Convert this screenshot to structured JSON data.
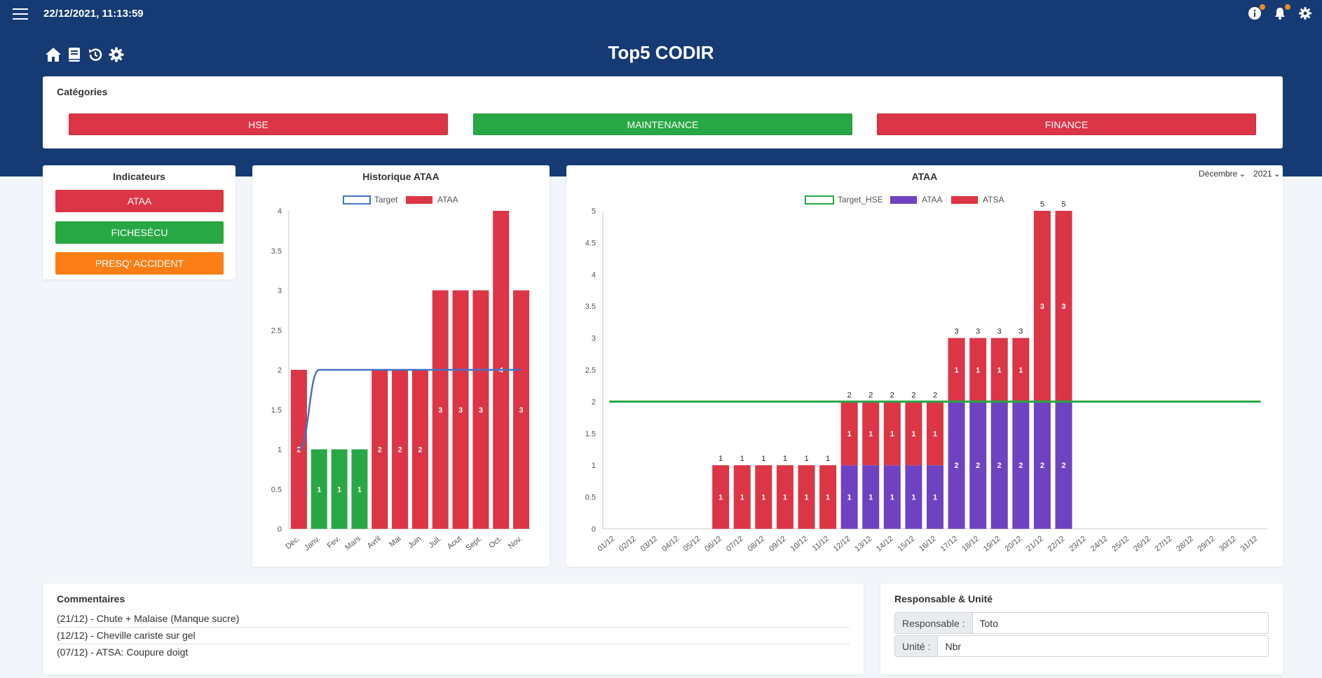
{
  "header": {
    "datetime": "22/12/2021, 11:13:59",
    "title": "Top5 CODIR"
  },
  "categories": {
    "label": "Catégories",
    "items": [
      {
        "label": "HSE",
        "color": "#dc3545"
      },
      {
        "label": "MAINTENANCE",
        "color": "#28a745"
      },
      {
        "label": "FINANCE",
        "color": "#dc3545"
      }
    ]
  },
  "indicators": {
    "title": "Indicateurs",
    "items": [
      {
        "label": "ATAA",
        "color": "#dc3545"
      },
      {
        "label": "FICHESÉCU",
        "color": "#28a745"
      },
      {
        "label": "PRESQ' ACCIDENT",
        "color": "#fd7e14"
      }
    ]
  },
  "selectors": {
    "month": "Décembre",
    "year": "2021"
  },
  "comments": {
    "title": "Commentaires",
    "items": [
      "(21/12) - Chute + Malaise (Manque sucre)",
      "(12/12) - Cheville cariste sur gel",
      "(07/12) - ATSA: Coupure doigt"
    ]
  },
  "responsable": {
    "title": "Responsable & Unité",
    "responsable_label": "Responsable :",
    "responsable_value": "Toto",
    "unite_label": "Unité :",
    "unite_value": "Nbr"
  },
  "chart_data": [
    {
      "type": "bar",
      "title": "Historique ATAA",
      "categories": [
        "Déc.",
        "Janv.",
        "Fev.",
        "Mars",
        "Avril",
        "Mai",
        "Juin",
        "Juil.",
        "Aout",
        "Sept.",
        "Oct.",
        "Nov."
      ],
      "series": [
        {
          "name": "ATAA",
          "type": "bar",
          "values": [
            2,
            1,
            1,
            1,
            2,
            2,
            2,
            3,
            3,
            3,
            4,
            3
          ],
          "colors": [
            "#dc3545",
            "#28a745",
            "#28a745",
            "#28a745",
            "#dc3545",
            "#dc3545",
            "#dc3545",
            "#dc3545",
            "#dc3545",
            "#dc3545",
            "#dc3545",
            "#dc3545"
          ]
        },
        {
          "name": "Target",
          "type": "line",
          "values": [
            1,
            2,
            2,
            2,
            2,
            2,
            2,
            2,
            2,
            2,
            2,
            2
          ],
          "color": "#4472c4"
        }
      ],
      "ylim": [
        0,
        4
      ],
      "yticks": [
        0,
        0.5,
        1,
        1.5,
        2,
        2.5,
        3,
        3.5,
        4
      ],
      "legend": "top",
      "grid": false
    },
    {
      "type": "bar",
      "stacked": true,
      "title": "ATAA",
      "categories": [
        "01/12",
        "02/12",
        "03/12",
        "04/12",
        "05/12",
        "06/12",
        "07/12",
        "08/12",
        "09/12",
        "10/12",
        "11/12",
        "12/12",
        "13/12",
        "14/12",
        "15/12",
        "16/12",
        "17/12",
        "18/12",
        "19/12",
        "20/12",
        "21/12",
        "22/12",
        "23/12",
        "24/12",
        "25/12",
        "26/12",
        "27/12",
        "28/12",
        "29/12",
        "30/12",
        "31/12"
      ],
      "series": [
        {
          "name": "ATAA",
          "color": "#6f42c1",
          "values": [
            null,
            null,
            null,
            null,
            null,
            0,
            0,
            0,
            0,
            0,
            0,
            1,
            1,
            1,
            1,
            1,
            2,
            2,
            2,
            2,
            2,
            2,
            null,
            null,
            null,
            null,
            null,
            null,
            null,
            null,
            null
          ]
        },
        {
          "name": "ATSA",
          "color": "#dc3545",
          "values": [
            null,
            null,
            null,
            null,
            null,
            1,
            1,
            1,
            1,
            1,
            1,
            1,
            1,
            1,
            1,
            1,
            1,
            1,
            1,
            1,
            3,
            3,
            null,
            null,
            null,
            null,
            null,
            null,
            null,
            null,
            null
          ]
        },
        {
          "name": "Target_HSE",
          "type": "line",
          "color": "#28a745",
          "value": 2
        }
      ],
      "totals": [
        null,
        null,
        null,
        null,
        null,
        1,
        1,
        1,
        1,
        1,
        1,
        2,
        2,
        2,
        2,
        2,
        3,
        3,
        3,
        3,
        5,
        5,
        null,
        null,
        null,
        null,
        null,
        null,
        null,
        null,
        null
      ],
      "ylim": [
        0,
        5
      ],
      "yticks": [
        0,
        0.5,
        1,
        1.5,
        2,
        2.5,
        3,
        3.5,
        4,
        4.5,
        5
      ],
      "legend": "top",
      "grid": false
    }
  ]
}
